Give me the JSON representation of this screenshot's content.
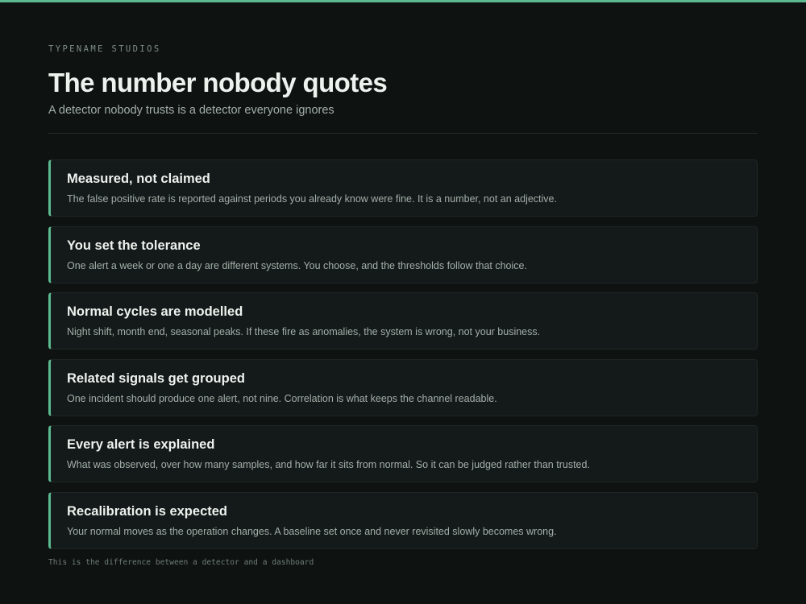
{
  "header": {
    "eyebrow": "TYPENAME STUDIOS",
    "title": "The number nobody quotes",
    "subtitle": "A detector nobody trusts is a detector everyone ignores"
  },
  "cards": [
    {
      "title": "Measured, not claimed",
      "body": "The false positive rate is reported against periods you already know were fine. It is a number, not an adjective."
    },
    {
      "title": "You set the tolerance",
      "body": "One alert a week or one a day are different systems. You choose, and the thresholds follow that choice."
    },
    {
      "title": "Normal cycles are modelled",
      "body": "Night shift, month end, seasonal peaks. If these fire as anomalies, the system is wrong, not your business."
    },
    {
      "title": "Related signals get grouped",
      "body": "One incident should produce one alert, not nine. Correlation is what keeps the channel readable."
    },
    {
      "title": "Every alert is explained",
      "body": "What was observed, over how many samples, and how far it sits from normal. So it can be judged rather than trusted."
    },
    {
      "title": "Recalibration is expected",
      "body": "Your normal moves as the operation changes. A baseline set once and never revisited slowly becomes wrong."
    }
  ],
  "footer": {
    "note": "This is the difference between a detector and a dashboard"
  },
  "colors": {
    "background": "#0e1312",
    "accent": "#5bb88f",
    "card_background": "#141a19",
    "heading": "#eef2ef",
    "body_text": "#a3aea9"
  }
}
